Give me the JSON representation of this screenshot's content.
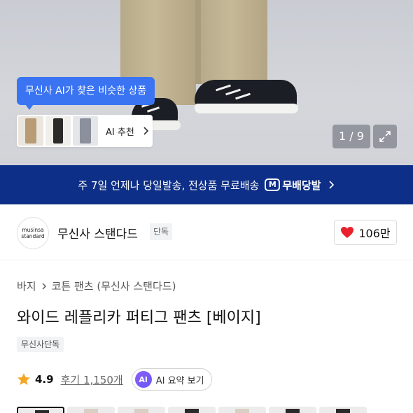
{
  "hero": {
    "ai_tooltip": "무신사 AI가 찾은 비슷한 상품",
    "ai_card_label": "AI 추천",
    "pager": "1 / 9"
  },
  "banner": {
    "text": "주 7일 언제나 당일발송, 전상품 무료배송",
    "logo_text": "무배당발"
  },
  "brand": {
    "logo_line1": "musinsa",
    "logo_line2": "standard",
    "name": "무신사 스탠다드",
    "badge": "단독",
    "likes": "106만"
  },
  "product": {
    "breadcrumb": [
      "바지",
      "코튼 팬츠 (무신사 스탠다드)"
    ],
    "title": "와이드 레플리카 퍼티그 팬츠 [베이지]",
    "exclusive_tag": "무신사단독",
    "rating": "4.9",
    "review_link": "후기 1,150개",
    "ai_badge": "AI",
    "ai_summary_label": "AI 요약 보기"
  },
  "colors": {
    "accent_blue": "#3a74f3",
    "banner_navy": "#0e2f87",
    "heart_red": "#e8212c",
    "star_orange": "#f5a623"
  }
}
